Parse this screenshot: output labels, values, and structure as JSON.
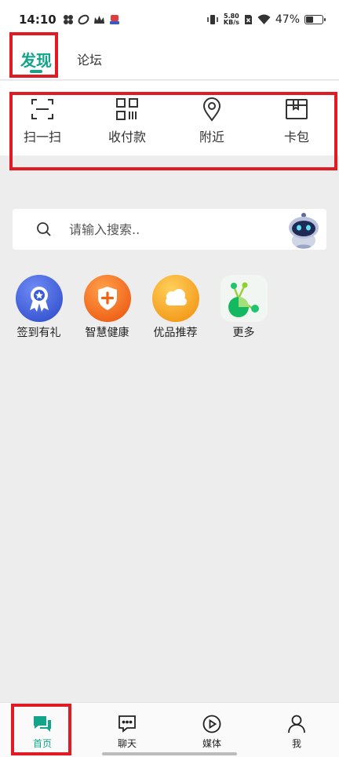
{
  "status_bar": {
    "time": "14:10",
    "net_speed_value": "5.80",
    "net_speed_unit": "KB/s",
    "battery_percent": "47%",
    "battery_level": 0.47
  },
  "tabs": [
    {
      "label": "发现",
      "active": true
    },
    {
      "label": "论坛",
      "active": false
    }
  ],
  "quick_actions": [
    {
      "label": "扫一扫",
      "icon": "scan-icon"
    },
    {
      "label": "收付款",
      "icon": "qr-code-icon"
    },
    {
      "label": "附近",
      "icon": "location-pin-icon"
    },
    {
      "label": "卡包",
      "icon": "card-wallet-icon"
    }
  ],
  "search": {
    "placeholder": "请输入搜索.."
  },
  "apps": [
    {
      "label": "签到有礼",
      "icon": "ribbon-badge-icon",
      "color": "#3a5bd9"
    },
    {
      "label": "智慧健康",
      "icon": "shield-plus-icon",
      "color": "#f2620f"
    },
    {
      "label": "优品推荐",
      "icon": "cloud-icon",
      "color": "#f5a10c"
    },
    {
      "label": "更多",
      "icon": "more-nodes-icon",
      "color": "#1fc46d"
    }
  ],
  "bottom_nav": [
    {
      "label": "首页",
      "icon": "chat-bubbles-icon",
      "active": true
    },
    {
      "label": "聊天",
      "icon": "message-dots-icon",
      "active": false
    },
    {
      "label": "媒体",
      "icon": "play-circle-icon",
      "active": false
    },
    {
      "label": "我",
      "icon": "person-icon",
      "active": false
    }
  ],
  "colors": {
    "accent": "#12a58a",
    "highlight": "#e01b24",
    "background": "#ededed"
  }
}
